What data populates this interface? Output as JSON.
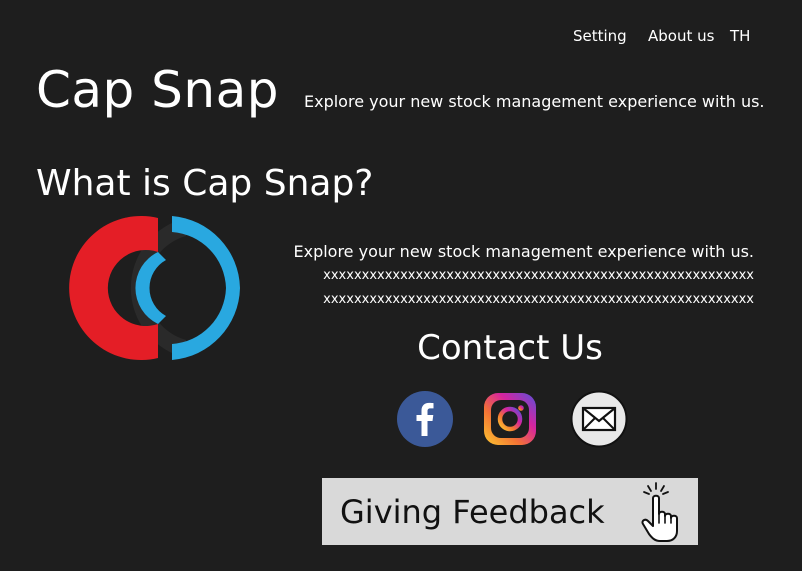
{
  "nav": {
    "setting": "Setting",
    "about": "About us",
    "language": "TH"
  },
  "header": {
    "brand": "Cap Snap",
    "tagline": "Explore your new stock management experience with us."
  },
  "about_section": {
    "title": "What is Cap Snap?",
    "logo_icon": "cap-snap-logo",
    "lines": [
      "Explore your new stock management experience with us.",
      "xxxxxxxxxxxxxxxxxxxxxxxxxxxxxxxxxxxxxxxxxxxxxxxxxxxxxxxx",
      "xxxxxxxxxxxxxxxxxxxxxxxxxxxxxxxxxxxxxxxxxxxxxxxxxxxxxxxx"
    ]
  },
  "contact": {
    "title": "Contact Us",
    "icons": [
      "facebook-icon",
      "instagram-icon",
      "email-icon"
    ]
  },
  "feedback": {
    "label": "Giving Feedback",
    "icon": "hand-pointer-icon"
  },
  "colors": {
    "background": "#1e1e1e",
    "logo_red": "#e41e26",
    "logo_blue": "#29a8e0",
    "facebook_blue": "#3b5998",
    "button_bg": "#d9d9d9"
  }
}
